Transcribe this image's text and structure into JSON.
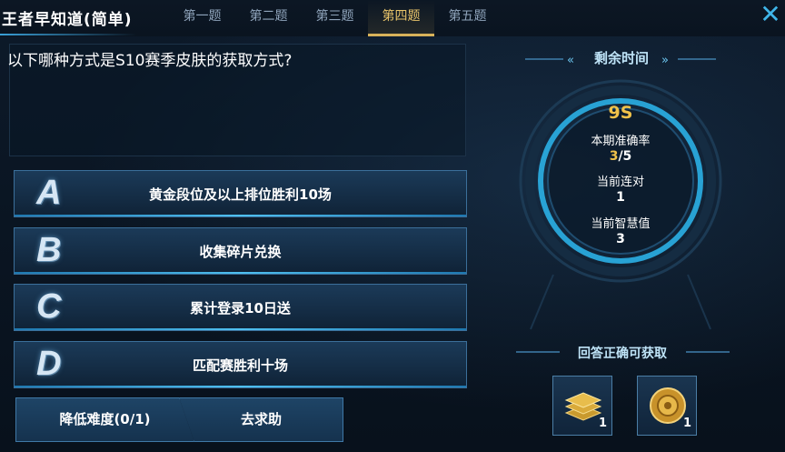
{
  "header": {
    "title": "王者早知道(简单)",
    "tabs": [
      "第一题",
      "第二题",
      "第三题",
      "第四题",
      "第五题"
    ],
    "active_tab_index": 3
  },
  "question": {
    "text": "以下哪种方式是S10赛季皮肤的获取方式?"
  },
  "options": [
    {
      "letter": "A",
      "text": "黄金段位及以上排位胜利10场"
    },
    {
      "letter": "B",
      "text": "收集碎片兑换"
    },
    {
      "letter": "C",
      "text": "累计登录10日送"
    },
    {
      "letter": "D",
      "text": "匹配赛胜利十场"
    }
  ],
  "actions": {
    "lower_difficulty": "降低难度(0/1)",
    "ask_help": "去求助"
  },
  "timer": {
    "label": "剩余时间",
    "value": "9S",
    "accuracy_label": "本期准确率",
    "accuracy_num": "3",
    "accuracy_den": "/5",
    "streak_label": "当前连对",
    "streak_value": "1",
    "wisdom_label": "当前智慧值",
    "wisdom_value": "3"
  },
  "rewards": {
    "title": "回答正确可获取",
    "items": [
      {
        "icon": "stacked-gold-bars-icon",
        "count": "1"
      },
      {
        "icon": "gold-coin-medal-icon",
        "count": "1"
      }
    ]
  },
  "colors": {
    "accent": "#3fb6ea",
    "gold": "#f0c24a",
    "active_tab": "#e9c46a"
  }
}
